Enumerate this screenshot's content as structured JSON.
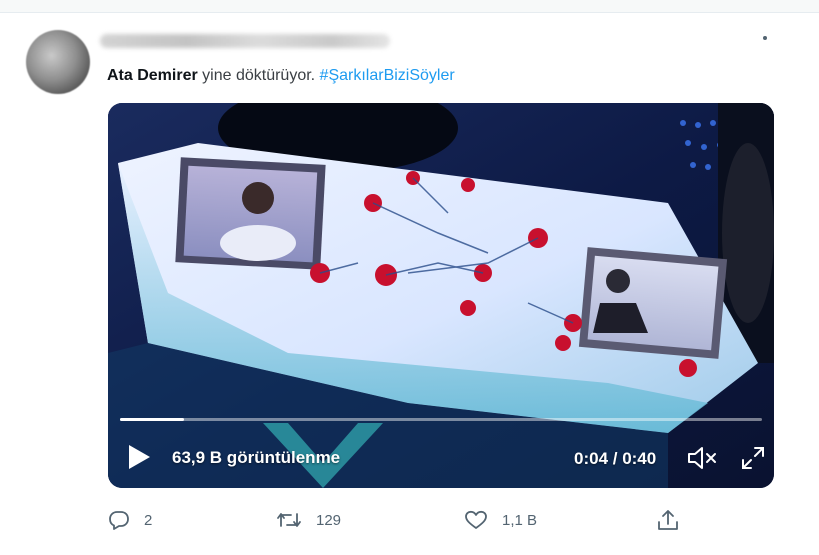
{
  "tweet": {
    "author": "Ata Demirer",
    "text": " yine döktürüyor. ",
    "hashtag": "#ŞarkılarBiziSöyler"
  },
  "video": {
    "progress_fraction": 0.1,
    "views_text": "63,9 B görüntülenme",
    "time_text": "0:04 / 0:40"
  },
  "actions": {
    "reply_count": "2",
    "retweet_count": "129",
    "like_count": "1,1 B"
  },
  "colors": {
    "hashtag": "#1d9bf0",
    "action_gray": "#536471"
  },
  "icons": [
    "avatar",
    "more-icon",
    "play-icon",
    "mute-icon",
    "fullscreen-icon",
    "reply-icon",
    "retweet-icon",
    "like-icon",
    "share-icon"
  ]
}
